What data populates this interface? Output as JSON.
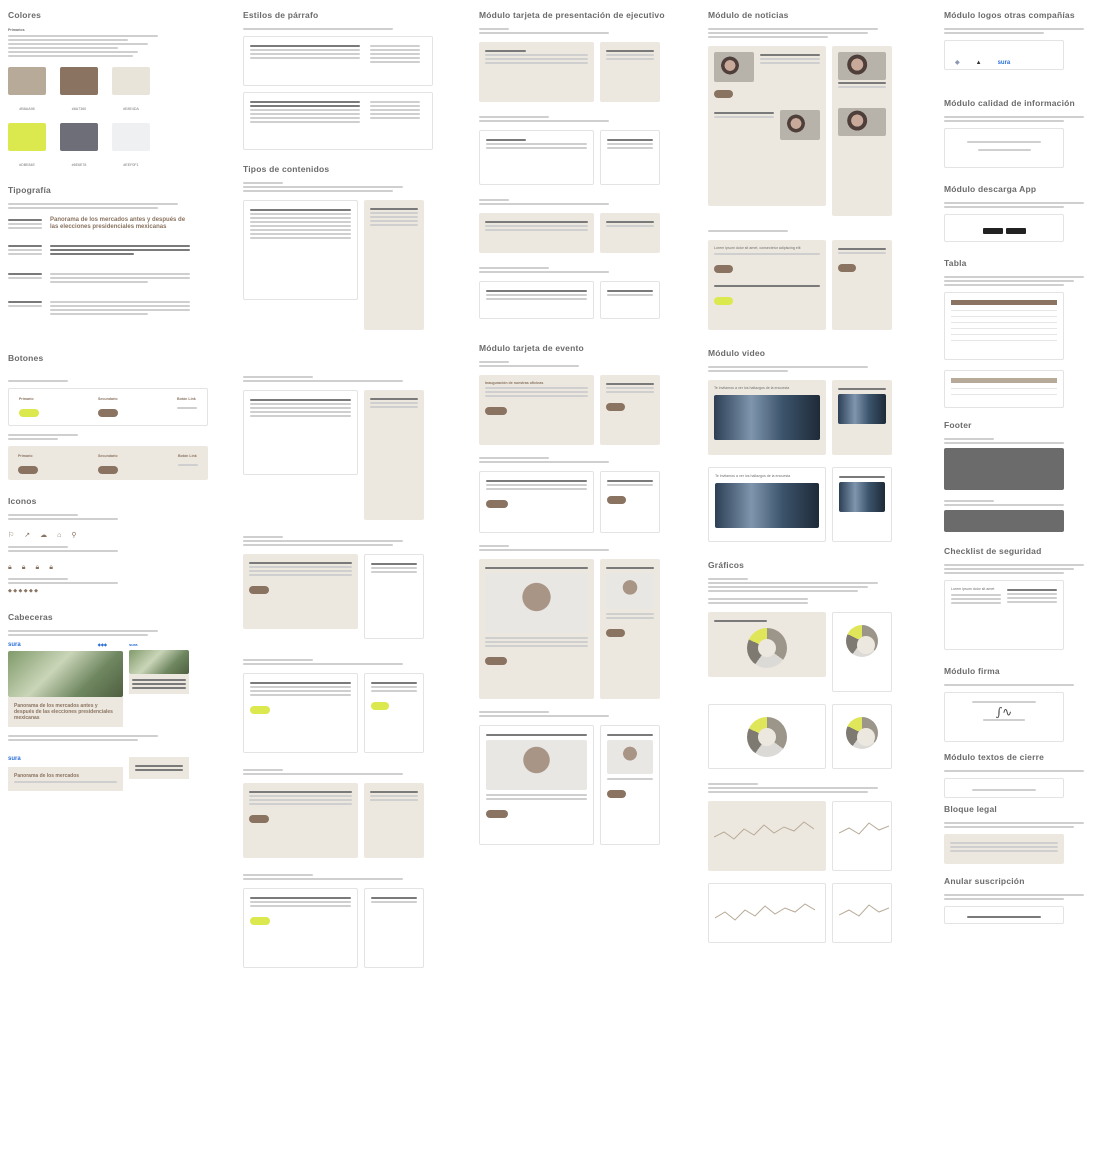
{
  "sections": {
    "colores": "Colores",
    "tipografia": "Tipografía",
    "botones": "Botones",
    "iconos": "Iconos",
    "cabeceras": "Cabeceras",
    "estilos_parrafo": "Estilos de párrafo",
    "tipos_contenidos": "Tipos de contenidos",
    "modulo_tarjeta_ejecutivo": "Módulo tarjeta de presentación de ejecutivo",
    "modulo_tarjeta_evento": "Módulo tarjeta de evento",
    "modulo_noticias": "Módulo de noticias",
    "modulo_video": "Módulo video",
    "graficos": "Gráficos",
    "modulo_logos": "Módulo logos otras compañías",
    "modulo_calidad": "Módulo calidad de información",
    "modulo_descarga": "Módulo descarga App",
    "tabla": "Tabla",
    "footer": "Footer",
    "checklist": "Checklist de seguridad",
    "modulo_firma": "Módulo firma",
    "modulo_textos_cierre": "Módulo textos de cierre",
    "bloque_legal": "Bloque legal",
    "anular_suscripcion": "Anular suscripción"
  },
  "colors": [
    {
      "hex": "#b8aa98",
      "label": "#B8AA98"
    },
    {
      "hex": "#8a7360",
      "label": "#8A7360"
    },
    {
      "hex": "#e8e4da",
      "label": "#E8E4DA"
    },
    {
      "hex": "#dbe84e",
      "label": "#DBE84E"
    },
    {
      "hex": "#6e6e78",
      "label": "#6E6E78"
    },
    {
      "hex": "#eef0f1",
      "label": "#EEF0F1"
    }
  ],
  "sura": "sura",
  "cabecera_title": "Panorama de los mercados antes y después de las elecciones presidenciales mexicanas",
  "tipografia_title": "Panorama de los mercados antes y después de las elecciones presidenciales mexicanas",
  "boton_primario": "Primario",
  "boton_secundario": "Secundario",
  "boton_link": "Botón Link",
  "evento_title": "Inauguración de nuestras oficinas",
  "video_title": "Te invitamos a ver los hallazgos de la encuesta",
  "noticia_title": "Lorem ipsum dolor sit amet, consectetur adipiscing elit",
  "checklist_item": "Lorem ipsum dolor sit amet"
}
